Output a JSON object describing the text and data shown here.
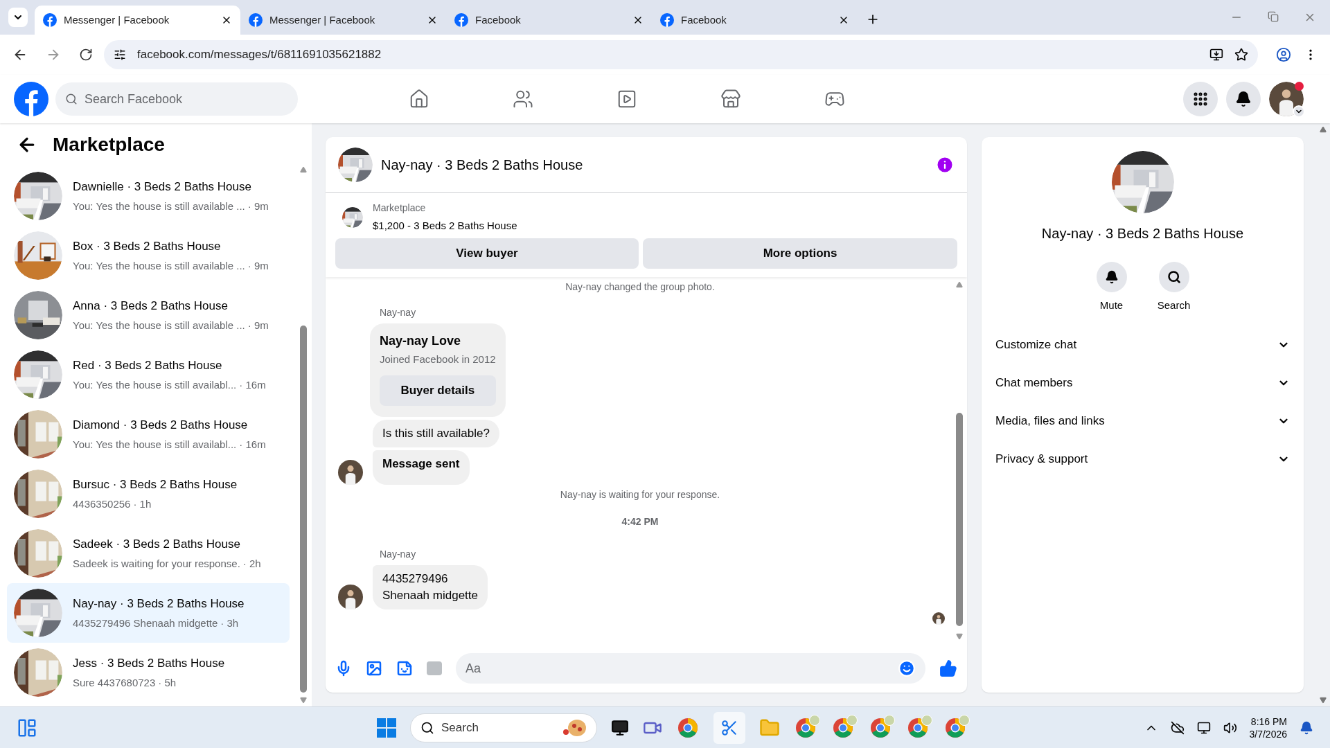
{
  "browser": {
    "tabs": [
      {
        "title": "Messenger | Facebook",
        "selected": true
      },
      {
        "title": "Messenger | Facebook",
        "selected": false
      },
      {
        "title": "Facebook",
        "selected": false
      },
      {
        "title": "Facebook",
        "selected": false
      }
    ],
    "url": "facebook.com/messages/t/6811691035621882"
  },
  "header": {
    "search_placeholder": "Search Facebook",
    "notification_badge": true
  },
  "sidebar": {
    "title": "Marketplace",
    "conversations": [
      {
        "name": "Dawnielle · 3 Beds 2 Baths House",
        "preview": "You: Yes the house is still available ...",
        "meta": "· 9m",
        "selected": false
      },
      {
        "name": "Box · 3 Beds 2 Baths House",
        "preview": "You: Yes the house is still available ...",
        "meta": "· 9m",
        "selected": false
      },
      {
        "name": "Anna · 3 Beds 2 Baths House",
        "preview": "You: Yes the house is still available ...",
        "meta": "· 9m",
        "selected": false
      },
      {
        "name": "Red · 3 Beds 2 Baths House",
        "preview": "You: Yes the house is still availabl...",
        "meta": "· 16m",
        "selected": false
      },
      {
        "name": "Diamond · 3 Beds 2 Baths House",
        "preview": "You: Yes the house is still availabl...",
        "meta": "· 16m",
        "selected": false
      },
      {
        "name": "Bursuc · 3 Beds 2 Baths House",
        "preview": "4436350256",
        "meta": "· 1h",
        "selected": false
      },
      {
        "name": "Sadeek · 3 Beds 2 Baths House",
        "preview": "Sadeek is waiting for your response.",
        "meta": "· 2h",
        "selected": false
      },
      {
        "name": "Nay-nay · 3 Beds 2 Baths House",
        "preview": "4435279496 Shenaah midgette",
        "meta": "· 3h",
        "selected": true
      },
      {
        "name": "Jess · 3 Beds 2 Baths House",
        "preview": "Sure 4437680723",
        "meta": "· 5h",
        "selected": false
      }
    ]
  },
  "chat": {
    "title": "Nay-nay · 3 Beds 2 Baths House",
    "listing": {
      "label": "Marketplace",
      "title": "$1,200 - 3 Beds 2 Baths House"
    },
    "buttons": [
      "View buyer",
      "More options"
    ],
    "messages": [
      {
        "kind": "system",
        "text": "Nay-nay changed the group photo."
      },
      {
        "kind": "sender",
        "text": "Nay-nay"
      },
      {
        "kind": "profile",
        "name": "Nay-nay Love",
        "subtitle": "Joined Facebook in 2012",
        "button": "Buyer details"
      },
      {
        "kind": "bubble",
        "lines": [
          "Is this still available?"
        ],
        "bold": false,
        "avatar": false
      },
      {
        "kind": "bubble",
        "lines": [
          "Message sent"
        ],
        "bold": true,
        "avatar": true
      },
      {
        "kind": "system",
        "text": "Nay-nay is waiting for your response."
      },
      {
        "kind": "time",
        "text": "4:42 PM"
      },
      {
        "kind": "sender",
        "text": "Nay-nay"
      },
      {
        "kind": "bubble",
        "lines": [
          "4435279496",
          "Shenaah midgette"
        ],
        "bold": false,
        "avatar": true
      }
    ],
    "composer_placeholder": "Aa"
  },
  "details": {
    "title": "Nay-nay · 3 Beds 2 Baths House",
    "actions": [
      {
        "label": "Mute",
        "kind": "mute"
      },
      {
        "label": "Search",
        "kind": "search"
      }
    ],
    "sections": [
      {
        "label": "Customize chat",
        "expanded": false
      },
      {
        "label": "Chat members",
        "expanded": false
      },
      {
        "label": "Media, files and links",
        "expanded": false
      },
      {
        "label": "Privacy & support",
        "expanded": false
      }
    ]
  },
  "taskbar": {
    "search_placeholder": "Search",
    "time": "8:16 PM",
    "date": "3/7/2026"
  }
}
